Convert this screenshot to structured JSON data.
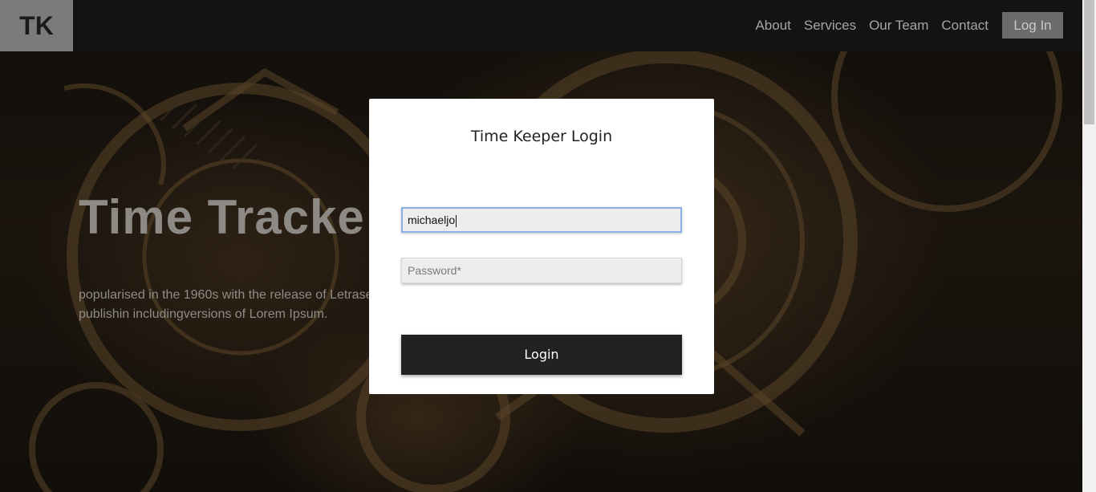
{
  "navbar": {
    "logo": "TK",
    "links": [
      "About",
      "Services",
      "Our Team",
      "Contact"
    ],
    "login_label": "Log In"
  },
  "hero": {
    "title": "Time Tracke",
    "text": "popularised in the 1960s with the release of Letrase passages, and more recently with desktop publishin includingversions of Lorem Ipsum."
  },
  "modal": {
    "title": "Time Keeper Login",
    "username_value": "michaeljo",
    "password_placeholder": "Password*",
    "login_button": "Login"
  },
  "colors": {
    "modal_bg": "#ffffff",
    "button_bg": "#222222",
    "focus_border": "#8ab0e6",
    "logo_bg": "#7b7b7b"
  }
}
